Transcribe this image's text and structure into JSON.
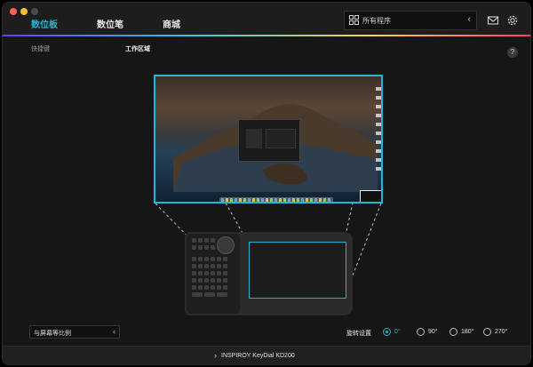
{
  "colors": {
    "accent": "#23b5d3",
    "traffic_close": "#ff5f57",
    "traffic_min": "#febc2e",
    "traffic_max": "#4a4a4a"
  },
  "header": {
    "tabs": [
      {
        "label": "数位板",
        "active": true
      },
      {
        "label": "数位笔",
        "active": false
      },
      {
        "label": "商城",
        "active": false
      }
    ],
    "app_select": {
      "value": "所有程序",
      "icon": "grid-icon",
      "arrow": "‹"
    },
    "mail_icon": "mail-icon",
    "settings_icon": "gear-icon"
  },
  "subnav": {
    "items": [
      {
        "label": "快捷键",
        "active": false
      },
      {
        "label": "工作区域",
        "active": true
      }
    ],
    "help": "?"
  },
  "mapping": {
    "screen": "desktop-wallpaper",
    "tablet": "INSPIROY KeyDial KD200"
  },
  "bottom": {
    "ratio_select": {
      "value": "与屏幕等比例",
      "arrow": "‹"
    },
    "rotation": {
      "label": "旋转设置",
      "options": [
        {
          "label": "0°",
          "selected": true
        },
        {
          "label": "90°",
          "selected": false
        },
        {
          "label": "180°",
          "selected": false
        },
        {
          "label": "270°",
          "selected": false
        }
      ]
    }
  },
  "footer": {
    "arrow": "›",
    "device": "INSPIROY KeyDial KD200"
  }
}
